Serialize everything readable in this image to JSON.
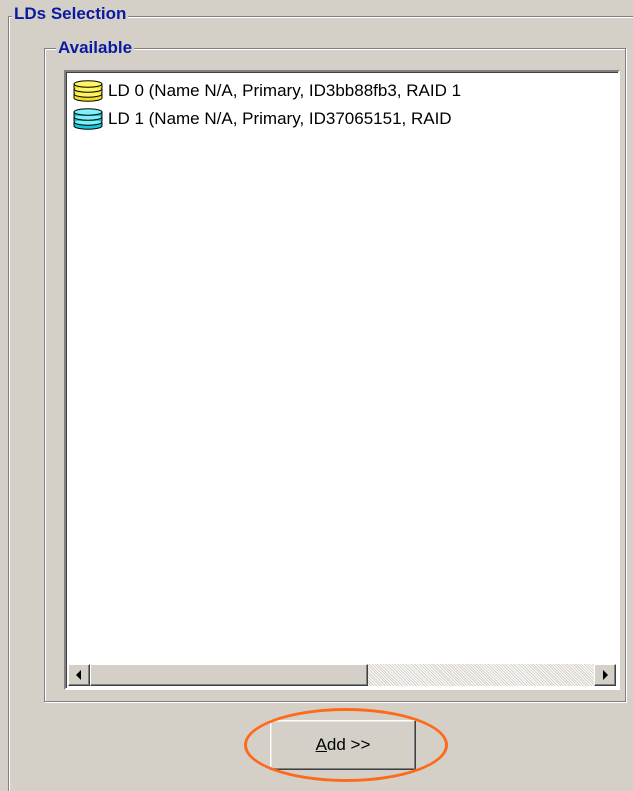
{
  "groups": {
    "outer_title": "LDs Selection",
    "inner_title": "Available"
  },
  "list": {
    "items": [
      {
        "label": "LD 0 (Name N/A, Primary, ID3bb88fb3, RAID 1",
        "icon": "disk-stack-yellow-icon",
        "color": "#f0e020"
      },
      {
        "label": "LD 1 (Name N/A, Primary, ID37065151, RAID",
        "icon": "disk-stack-cyan-icon",
        "color": "#10c8d8"
      }
    ]
  },
  "scrollbar": {
    "position": 0
  },
  "add_button": {
    "mnemonic": "A",
    "rest": "dd >>"
  },
  "colors": {
    "title_blue": "#0a1aa0",
    "highlight_orange": "#ff6a1a",
    "face": "#d4d0c8"
  }
}
